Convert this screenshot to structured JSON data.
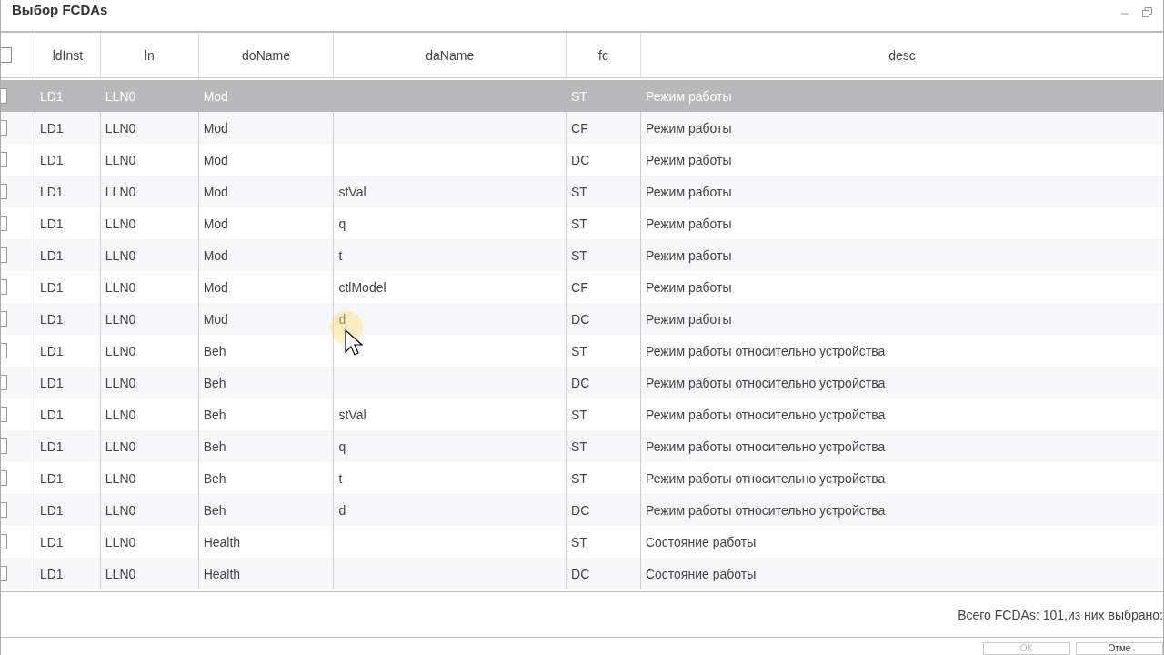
{
  "window": {
    "title": "Выбор FCDAs"
  },
  "table": {
    "header_checkbox": {
      "checked": false
    },
    "columns": [
      "ldInst",
      "ln",
      "doName",
      "daName",
      "fc",
      "desc"
    ],
    "rows": [
      {
        "selected": true,
        "checked": false,
        "cells": [
          "LD1",
          "LLN0",
          "Mod",
          "",
          "ST",
          "Режим работы"
        ]
      },
      {
        "selected": false,
        "checked": false,
        "cells": [
          "LD1",
          "LLN0",
          "Mod",
          "",
          "CF",
          "Режим работы"
        ]
      },
      {
        "selected": false,
        "checked": false,
        "cells": [
          "LD1",
          "LLN0",
          "Mod",
          "",
          "DC",
          "Режим работы"
        ]
      },
      {
        "selected": false,
        "checked": false,
        "cells": [
          "LD1",
          "LLN0",
          "Mod",
          "stVal",
          "ST",
          "Режим работы"
        ]
      },
      {
        "selected": false,
        "checked": false,
        "cells": [
          "LD1",
          "LLN0",
          "Mod",
          "q",
          "ST",
          "Режим работы"
        ]
      },
      {
        "selected": false,
        "checked": false,
        "cells": [
          "LD1",
          "LLN0",
          "Mod",
          "t",
          "ST",
          "Режим работы"
        ]
      },
      {
        "selected": false,
        "checked": false,
        "cells": [
          "LD1",
          "LLN0",
          "Mod",
          "ctlModel",
          "CF",
          "Режим работы"
        ]
      },
      {
        "selected": false,
        "checked": false,
        "cells": [
          "LD1",
          "LLN0",
          "Mod",
          "d",
          "DC",
          "Режим работы"
        ]
      },
      {
        "selected": false,
        "checked": false,
        "cells": [
          "LD1",
          "LLN0",
          "Beh",
          "",
          "ST",
          "Режим работы относительно устройства"
        ]
      },
      {
        "selected": false,
        "checked": false,
        "cells": [
          "LD1",
          "LLN0",
          "Beh",
          "",
          "DC",
          "Режим работы относительно устройства"
        ]
      },
      {
        "selected": false,
        "checked": false,
        "cells": [
          "LD1",
          "LLN0",
          "Beh",
          "stVal",
          "ST",
          "Режим работы относительно устройства"
        ]
      },
      {
        "selected": false,
        "checked": false,
        "cells": [
          "LD1",
          "LLN0",
          "Beh",
          "q",
          "ST",
          "Режим работы относительно устройства"
        ]
      },
      {
        "selected": false,
        "checked": false,
        "cells": [
          "LD1",
          "LLN0",
          "Beh",
          "t",
          "ST",
          "Режим работы относительно устройства"
        ]
      },
      {
        "selected": false,
        "checked": false,
        "cells": [
          "LD1",
          "LLN0",
          "Beh",
          "d",
          "DC",
          "Режим работы относительно устройства"
        ]
      },
      {
        "selected": false,
        "checked": false,
        "cells": [
          "LD1",
          "LLN0",
          "Health",
          "",
          "ST",
          "Состояние работы"
        ]
      },
      {
        "selected": false,
        "checked": false,
        "cells": [
          "LD1",
          "LLN0",
          "Health",
          "",
          "DC",
          "Состояние работы"
        ]
      }
    ]
  },
  "status": "Всего FCDAs: 101,из них выбрано:",
  "buttons": [
    {
      "label": "OK",
      "disabled": true
    },
    {
      "label": "Отме",
      "disabled": false
    }
  ]
}
